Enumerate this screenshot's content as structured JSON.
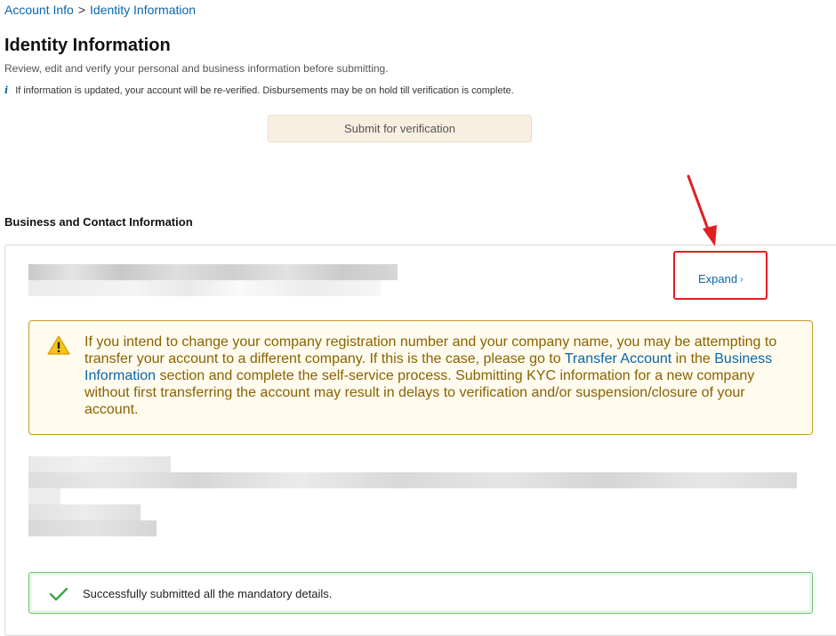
{
  "breadcrumb": {
    "parent": "Account Info",
    "separator": ">",
    "current": "Identity Information"
  },
  "page": {
    "title": "Identity Information",
    "subtitle": "Review, edit and verify your personal and business information before submitting.",
    "notice_icon": "i",
    "notice": "If information is updated, your account will be re-verified. Disbursements may be on hold till verification is complete."
  },
  "actions": {
    "submit_label": "Submit for verification"
  },
  "section": {
    "heading": "Business and Contact Information",
    "expand_label": "Expand",
    "expand_chevron": "›"
  },
  "warning": {
    "icon": "warning-icon",
    "text_before": "If you intend to change your company registration number and your company name, you may be attempting to transfer your account to a different company. If this is the case, please go to ",
    "link1": "Transfer Account",
    "text_middle": " in the ",
    "link2": "Business Information",
    "text_after": " section and complete the self-service process. Submitting KYC information for a new company without first transferring the account may result in delays to verification and/or suspension/closure of your account."
  },
  "success": {
    "icon": "checkmark-icon",
    "text": "Successfully submitted all the mandatory details."
  },
  "colors": {
    "link": "#0b66a8",
    "warning_text": "#8a6200",
    "warning_border": "#c69b2b",
    "success_border": "#6cc36f",
    "highlight": "#e02020"
  }
}
